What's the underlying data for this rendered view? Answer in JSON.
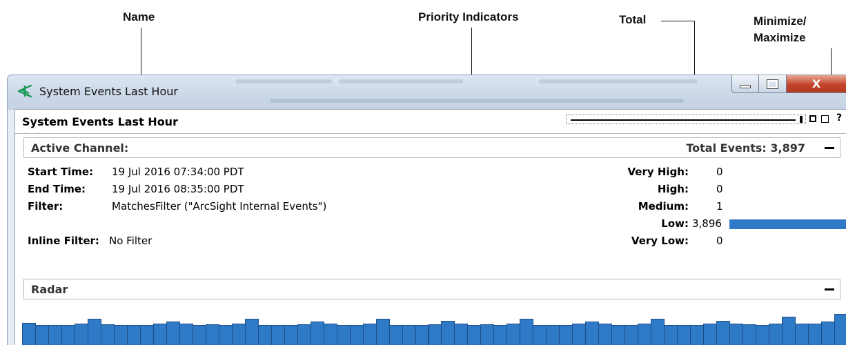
{
  "callouts": {
    "name": "Name",
    "priority": "Priority Indicators",
    "total": "Total",
    "minmax_line1": "Minimize/",
    "minmax_line2": "Maximize"
  },
  "window": {
    "title": "System Events Last Hour",
    "close_label": "X"
  },
  "panel": {
    "title": "System Events Last Hour",
    "help_label": "?"
  },
  "active_channel": {
    "label": "Active Channel:",
    "total_events": "Total Events: 3,897"
  },
  "details": {
    "start_label": "Start Time:",
    "start_value": "19 Jul 2016 07:34:00 PDT",
    "end_label": "End Time:",
    "end_value": "19 Jul 2016 08:35:00 PDT",
    "filter_label": "Filter:",
    "filter_value": "MatchesFilter (\"ArcSight Internal Events\")",
    "inline_label": "Inline Filter:",
    "inline_value": "No Filter"
  },
  "priorities": [
    {
      "label": "Very High:",
      "value": "0",
      "count": 0
    },
    {
      "label": "High:",
      "value": "0",
      "count": 0
    },
    {
      "label": "Medium:",
      "value": "1",
      "count": 1
    },
    {
      "label": "Low:",
      "value": "3,896",
      "count": 3896
    },
    {
      "label": "Very Low:",
      "value": "0",
      "count": 0
    }
  ],
  "radar": {
    "label": "Radar",
    "bar_color": "#2f7ac7",
    "levels": [
      0.78,
      0.72,
      0.72,
      0.72,
      0.76,
      0.92,
      0.74,
      0.72,
      0.72,
      0.72,
      0.76,
      0.84,
      0.76,
      0.72,
      0.74,
      0.72,
      0.76,
      0.92,
      0.72,
      0.72,
      0.72,
      0.74,
      0.84,
      0.76,
      0.72,
      0.72,
      0.76,
      0.92,
      0.72,
      0.72,
      0.72,
      0.74,
      0.86,
      0.76,
      0.72,
      0.74,
      0.72,
      0.76,
      0.92,
      0.72,
      0.72,
      0.72,
      0.76,
      0.84,
      0.76,
      0.72,
      0.72,
      0.76,
      0.92,
      0.72,
      0.72,
      0.72,
      0.76,
      0.86,
      0.76,
      0.74,
      0.72,
      0.76,
      1.0,
      0.76,
      0.76,
      0.84,
      1.1
    ]
  }
}
